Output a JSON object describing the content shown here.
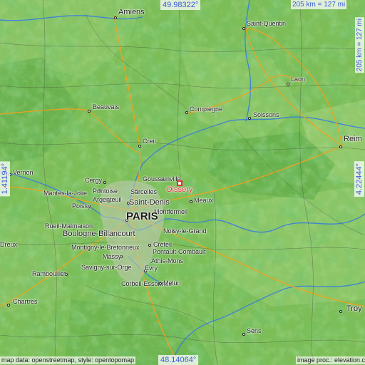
{
  "map": {
    "highlight": {
      "name": "Oissery",
      "color": "#e0303a"
    },
    "coordinates": {
      "top": "49.98322°",
      "bottom": "48.14064°",
      "left": "1.41194°",
      "right": "4.22444°"
    },
    "scale": {
      "horizontal": "205 km = 127 mi",
      "vertical": "205 km = 127 mi"
    },
    "attribution": {
      "left": "map data: openstreetmap, style: opentopomap",
      "right": "image proc.: elevation.city"
    },
    "colors": {
      "lowland": "#7fbf5a",
      "upland": "#3f9a3a",
      "river": "#3a7fd9",
      "road": "#f2a21a",
      "coord_text": "#3a5bd8"
    },
    "places": [
      {
        "key": "amiens",
        "name": "Amiens"
      },
      {
        "key": "saint_quentin",
        "name": "Saint-Quentin"
      },
      {
        "key": "laon",
        "name": "Laon"
      },
      {
        "key": "beauvais",
        "name": "Beauvais"
      },
      {
        "key": "compiegne",
        "name": "Compiègne"
      },
      {
        "key": "soissons",
        "name": "Soissons"
      },
      {
        "key": "reims",
        "name": "Reim"
      },
      {
        "key": "creil",
        "name": "Creil"
      },
      {
        "key": "vernon",
        "name": "Vernon"
      },
      {
        "key": "goussainville",
        "name": "Goussainville"
      },
      {
        "key": "cergy",
        "name": "Cergy"
      },
      {
        "key": "pontoise",
        "name": "Pontoise"
      },
      {
        "key": "sarcelles",
        "name": "Sarcelles"
      },
      {
        "key": "mantes",
        "name": "Mantes-la-Jolie"
      },
      {
        "key": "argenteuil",
        "name": "Argenteuil"
      },
      {
        "key": "saint_denis",
        "name": "Saint-Denis"
      },
      {
        "key": "meaux",
        "name": "Meaux"
      },
      {
        "key": "poissy",
        "name": "Poissy"
      },
      {
        "key": "montfermeil",
        "name": "Montfermeil"
      },
      {
        "key": "paris",
        "name": "PARIS"
      },
      {
        "key": "rueil",
        "name": "Rueil-Malmaison"
      },
      {
        "key": "noisy",
        "name": "Noisy-le-Grand"
      },
      {
        "key": "boulogne",
        "name": "Boulogne-Billancourt"
      },
      {
        "key": "dreux",
        "name": "Dreux"
      },
      {
        "key": "creteil",
        "name": "Créteil"
      },
      {
        "key": "pontault",
        "name": "Pontault-Combault"
      },
      {
        "key": "montigny",
        "name": "Montigny-le-Bretonneux"
      },
      {
        "key": "massy",
        "name": "Massy"
      },
      {
        "key": "athis",
        "name": "Athis-Mons"
      },
      {
        "key": "savigny",
        "name": "Savigny-sur-Orge"
      },
      {
        "key": "rambouillet",
        "name": "Rambouillet"
      },
      {
        "key": "evry",
        "name": "Évry"
      },
      {
        "key": "corbeil",
        "name": "Corbeil-Essonnes"
      },
      {
        "key": "melun",
        "name": "Melun"
      },
      {
        "key": "chartres",
        "name": "Chartres"
      },
      {
        "key": "troyes",
        "name": "Troy"
      },
      {
        "key": "sens",
        "name": "Sens"
      }
    ]
  }
}
